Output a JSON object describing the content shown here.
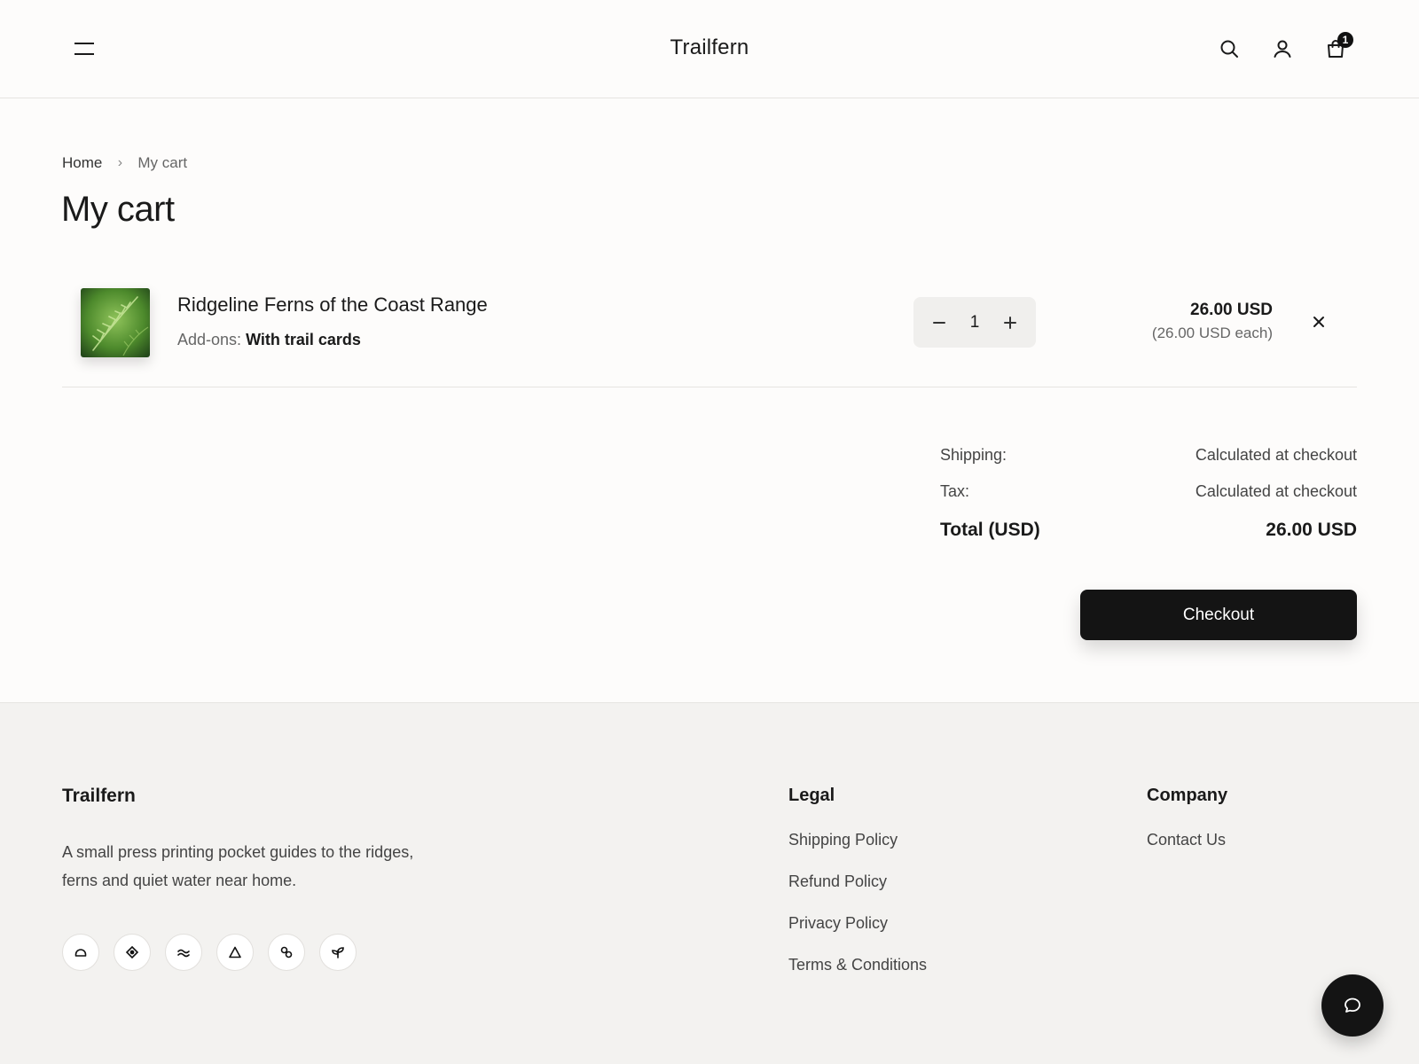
{
  "header": {
    "brand": "Trailfern",
    "cart_count": "1",
    "icons": [
      "menu-icon",
      "search-icon",
      "account-icon",
      "cart-icon"
    ]
  },
  "breadcrumb": {
    "home": "Home",
    "separator": "›",
    "current": "My cart"
  },
  "page_title": "My cart",
  "cart": {
    "items": [
      {
        "name": "Ridgeline Ferns of the Coast Range",
        "addons_label": "Add-ons:",
        "addons_value": "With trail cards",
        "quantity": "1",
        "price": "26.00 USD",
        "price_each": "(26.00 USD each)"
      }
    ]
  },
  "summary": {
    "shipping_label": "Shipping:",
    "shipping_value": "Calculated at checkout",
    "tax_label": "Tax:",
    "tax_value": "Calculated at checkout",
    "total_label": "Total (USD)",
    "total_value": "26.00 USD",
    "checkout_label": "Checkout"
  },
  "footer": {
    "brand": "Trailfern",
    "description": "A small press printing pocket guides to the ridges, ferns and quiet water near home.",
    "social_icons": [
      "dome-icon",
      "diamond-icon",
      "wave-icon",
      "triangle-icon",
      "links-icon",
      "sprout-icon"
    ],
    "legal": {
      "title": "Legal",
      "links": [
        "Shipping Policy",
        "Refund Policy",
        "Privacy Policy",
        "Terms & Conditions"
      ]
    },
    "company": {
      "title": "Company",
      "links": [
        "Contact Us"
      ]
    }
  },
  "colors": {
    "background": "#fdfcfb",
    "footer_bg": "#f3f2f0",
    "accent": "#141414",
    "text": "#1a1a1a",
    "muted": "#666666"
  }
}
